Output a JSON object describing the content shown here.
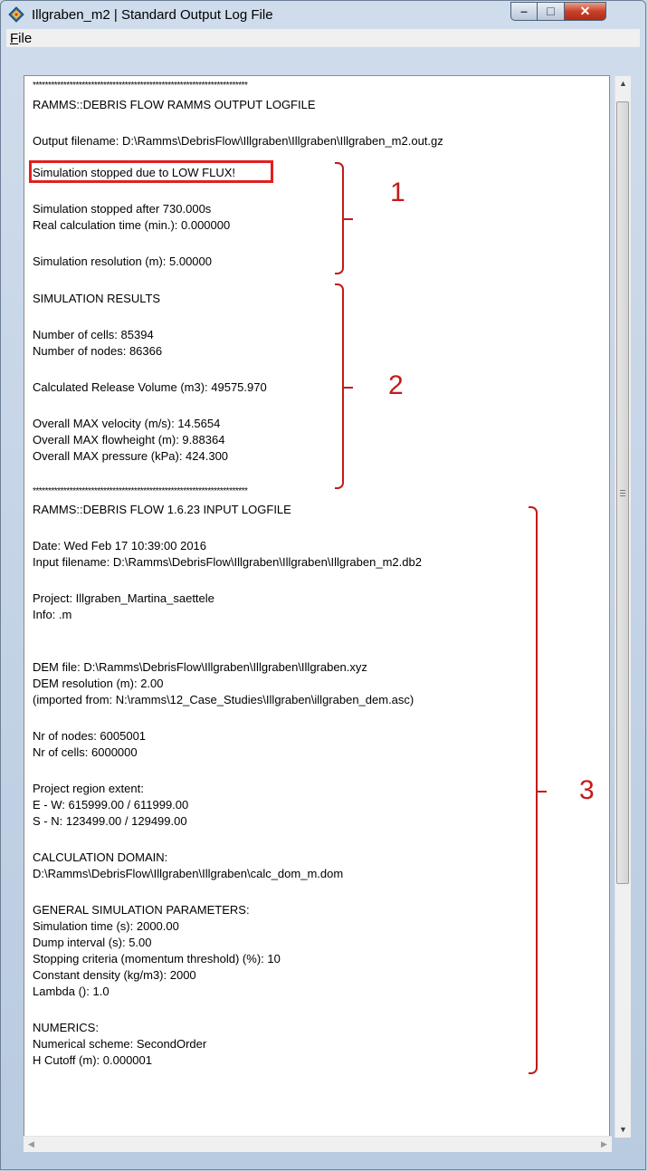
{
  "window": {
    "title": "Illgraben_m2 | Standard Output Log File",
    "controls": {
      "minimize": "–",
      "maximize": "□",
      "close": "✕"
    }
  },
  "menu": {
    "file_accel": "F",
    "file_rest": "ile"
  },
  "log": {
    "separator": "**********************************************************************",
    "output_header": "RAMMS::DEBRIS FLOW RAMMS OUTPUT LOGFILE",
    "output_filename": "Output filename: D:\\Ramms\\DebrisFlow\\Illgraben\\Illgraben\\Illgraben_m2.out.gz",
    "stopped_reason": "Simulation stopped due to LOW FLUX!",
    "stopped_after": "Simulation stopped after 730.000s",
    "real_calc_time": "Real calculation time (min.): 0.000000",
    "resolution": "Simulation resolution (m): 5.00000",
    "results_header": "SIMULATION RESULTS",
    "num_cells": "Number of cells: 85394",
    "num_nodes": "Number of nodes: 86366",
    "release_volume": "Calculated Release Volume (m3): 49575.970",
    "max_velocity": "Overall MAX velocity (m/s): 14.5654",
    "max_flowheight": "Overall MAX flowheight (m): 9.88364",
    "max_pressure": "Overall MAX pressure (kPa): 424.300",
    "input_header": "RAMMS::DEBRIS FLOW 1.6.23 INPUT LOGFILE",
    "date": "Date: Wed Feb 17 10:39:00 2016",
    "input_filename": "Input filename: D:\\Ramms\\DebrisFlow\\Illgraben\\Illgraben\\Illgraben_m2.db2",
    "project": "Project: Illgraben_Martina_saettele",
    "info": "Info: .m",
    "dem_file": "DEM file: D:\\Ramms\\DebrisFlow\\Illgraben\\Illgraben\\Illgraben.xyz",
    "dem_resolution": "DEM resolution (m): 2.00",
    "dem_imported": "(imported from: N:\\ramms\\12_Case_Studies\\Illgraben\\illgraben_dem.asc)",
    "nr_nodes": "Nr of nodes: 6005001",
    "nr_cells": "Nr of cells: 6000000",
    "region_header": "Project region extent:",
    "ew": "E - W: 615999.00 / 611999.00",
    "sn": "S - N: 123499.00 / 129499.00",
    "calc_domain_header": "CALCULATION DOMAIN:",
    "calc_domain_path": "D:\\Ramms\\DebrisFlow\\Illgraben\\Illgraben\\calc_dom_m.dom",
    "general_header": "GENERAL SIMULATION PARAMETERS:",
    "sim_time": "Simulation time (s): 2000.00",
    "dump_interval": "Dump interval (s): 5.00",
    "stopping_criteria": "Stopping criteria (momentum threshold) (%): 10",
    "density": "Constant density (kg/m3): 2000",
    "lambda": "Lambda (): 1.0",
    "numerics_header": "NUMERICS:",
    "scheme": "Numerical scheme: SecondOrder",
    "h_cutoff": "H Cutoff (m): 0.000001"
  },
  "annotations": {
    "one": "1",
    "two": "2",
    "three": "3"
  },
  "colors": {
    "annotation": "#c41a1a",
    "highlight": "#e02020"
  }
}
